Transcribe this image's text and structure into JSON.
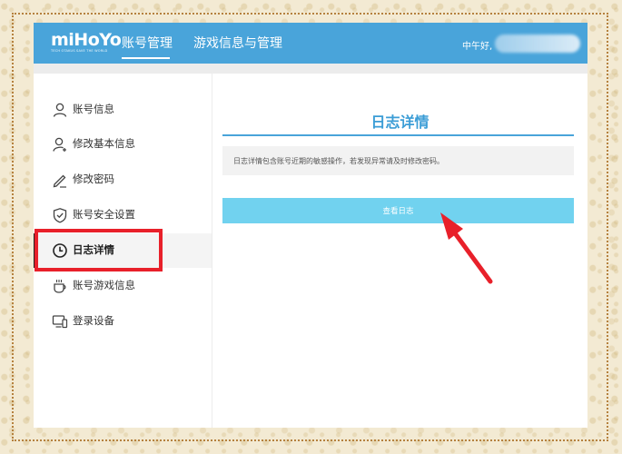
{
  "header": {
    "logo_text": "miHoYo",
    "logo_tagline": "TECH OTAKUS SAVE THE WORLD",
    "nav": [
      {
        "label": "账号管理",
        "active": true
      },
      {
        "label": "游戏信息与管理",
        "active": false
      }
    ],
    "greeting": "中午好,"
  },
  "sidebar": {
    "items": [
      {
        "label": "账号信息",
        "icon": "user-icon"
      },
      {
        "label": "修改基本信息",
        "icon": "user-edit-icon"
      },
      {
        "label": "修改密码",
        "icon": "pencil-icon"
      },
      {
        "label": "账号安全设置",
        "icon": "shield-check-icon"
      },
      {
        "label": "日志详情",
        "icon": "clock-icon",
        "active": true
      },
      {
        "label": "账号游戏信息",
        "icon": "cup-icon"
      },
      {
        "label": "登录设备",
        "icon": "devices-icon"
      }
    ]
  },
  "main": {
    "title": "日志详情",
    "notice": "日志详情包含账号近期的敏感操作，若发现异常请及时修改密码。",
    "view_log_button": "查看日志"
  },
  "colors": {
    "header_bg": "#49a4da",
    "button_bg": "#71d2ef",
    "title": "#3b9dd6",
    "annotation_red": "#e8202a"
  }
}
